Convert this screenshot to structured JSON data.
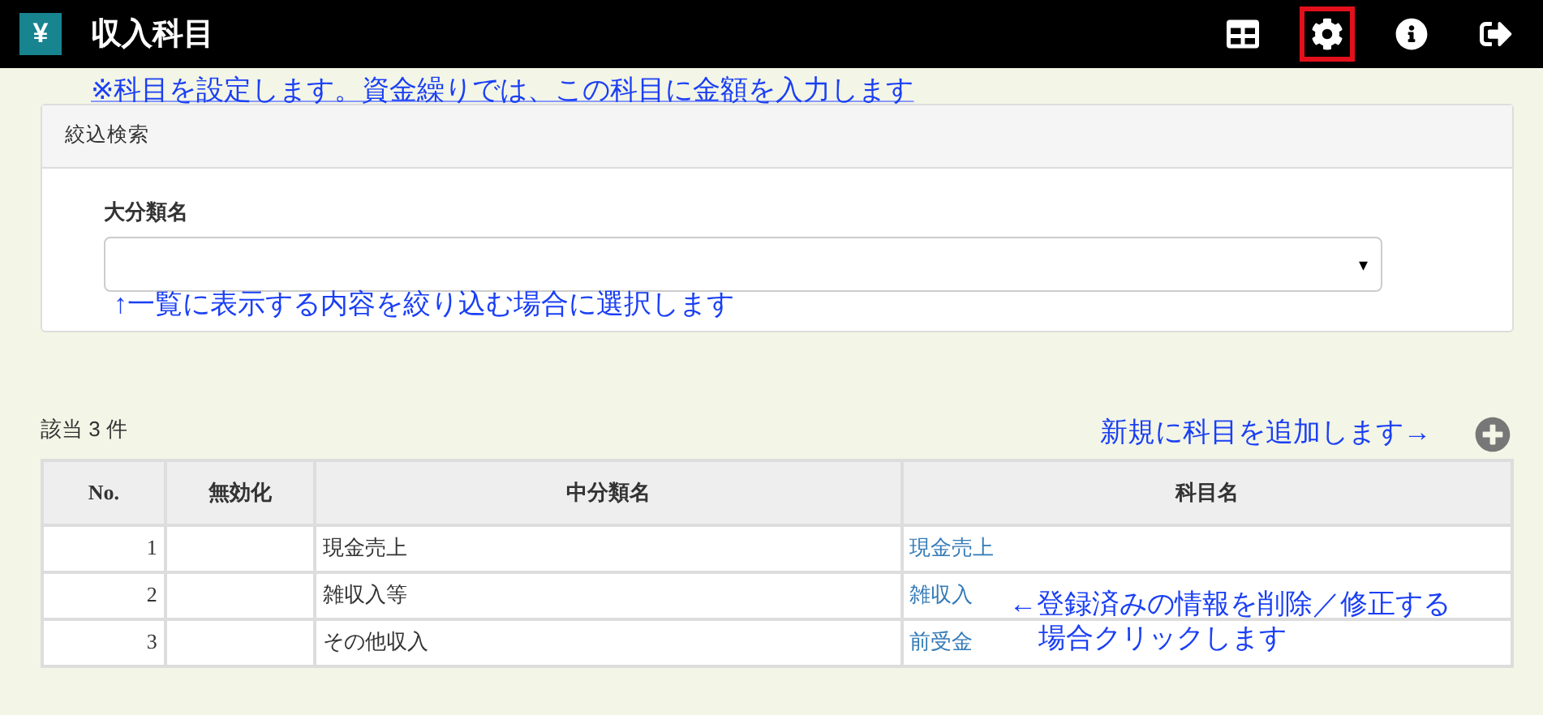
{
  "header": {
    "logo": "¥",
    "title": "収入科目",
    "toolbar": [
      {
        "highlighted": false
      },
      {
        "highlighted": true
      },
      {
        "highlighted": false
      },
      {
        "highlighted": false
      }
    ]
  },
  "notes": {
    "top": "※科目を設定します。資金繰りでは、この科目に金額を入力します",
    "filter": "↑一覧に表示する内容を絞り込む場合に選択します",
    "add": "新規に科目を追加します→",
    "edit": [
      "←登録済みの情報を削除／修正する",
      "場合クリックします"
    ]
  },
  "filter": {
    "title": "絞込検索",
    "label": "大分類名",
    "select_caret": "▾"
  },
  "count": "該当 3 件",
  "table": {
    "columns": [
      "No.",
      "無効化",
      "中分類名",
      "科目名"
    ],
    "rows": [
      {
        "no": "1",
        "disabled": "",
        "category": "現金売上",
        "name": "現金売上"
      },
      {
        "no": "2",
        "disabled": "",
        "category": "雑収入等",
        "name": "雑収入"
      },
      {
        "no": "3",
        "disabled": "",
        "category": "その他収入",
        "name": "前受金"
      }
    ]
  }
}
